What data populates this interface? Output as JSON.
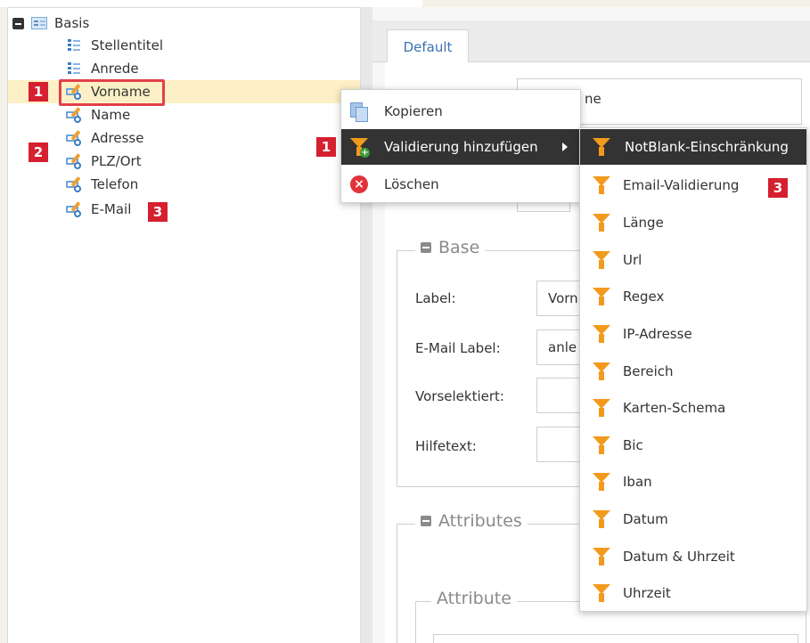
{
  "tree": {
    "root_label": "Basis",
    "items": [
      {
        "label": "Stellentitel",
        "icon": "list-icon"
      },
      {
        "label": "Anrede",
        "icon": "list-icon"
      },
      {
        "label": "Vorname",
        "icon": "text-field-icon"
      },
      {
        "label": "Name",
        "icon": "text-field-icon"
      },
      {
        "label": "Adresse",
        "icon": "text-field-icon"
      },
      {
        "label": "PLZ/Ort",
        "icon": "text-field-icon"
      },
      {
        "label": "Telefon",
        "icon": "text-field-icon"
      },
      {
        "label": "E-Mail",
        "icon": "text-field-icon"
      }
    ],
    "selected": "Vorname"
  },
  "badges": {
    "b1_tree": "1",
    "b2_tree": "2",
    "b3_tree": "3",
    "b1_menu": "1",
    "b3_submenu": "3"
  },
  "tabs": {
    "default_label": "Default"
  },
  "form": {
    "top_input_fragment": "ne",
    "base_legend": "Base",
    "labels": {
      "label": "Label:",
      "email_label": "E-Mail Label:",
      "vorselektiert": "Vorselektiert:",
      "hilfetext": "Hilfetext:"
    },
    "values": {
      "label": "Vorn",
      "email_label": "anle"
    },
    "attributes_legend": "Attributes",
    "attribute_legend": "Attribute"
  },
  "context_menu": {
    "copy": "Kopieren",
    "add_validation": "Validierung hinzufügen",
    "delete": "Löschen"
  },
  "submenu": {
    "items": [
      "NotBlank-Einschränkung",
      "Email-Validierung",
      "Länge",
      "Url",
      "Regex",
      "IP-Adresse",
      "Bereich",
      "Karten-Schema",
      "Bic",
      "Iban",
      "Datum",
      "Datum & Uhrzeit",
      "Uhrzeit"
    ],
    "active_index": 0
  },
  "colors": {
    "badge_red": "#d5202f",
    "selection_yellow": "#fdf0c6",
    "menu_active": "#333333",
    "funnel_orange": "#f29a1c",
    "link_blue": "#3b73b0"
  }
}
